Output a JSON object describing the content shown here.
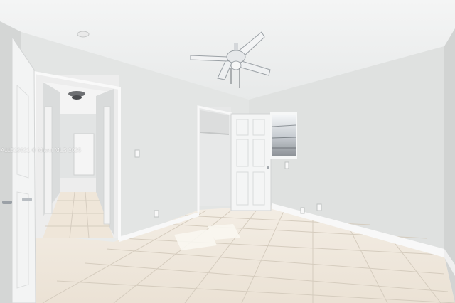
{
  "photo": {
    "watermark": "A11813921 © Miami MLS 2025"
  },
  "colors": {
    "ceiling": "#f1f2f2",
    "wall_back": "#e4e6e5",
    "wall_right": "#e0e2e1",
    "wall_left": "#dcdedd",
    "floor_tile": "#efe7dc",
    "grout": "#d6cdc0",
    "baseboard": "#f7f7f7",
    "door": "#f4f5f5"
  },
  "icons": [
    "ceiling-fan-icon",
    "ceiling-light-icon",
    "smoke-detector-icon",
    "door-knob-icon"
  ]
}
